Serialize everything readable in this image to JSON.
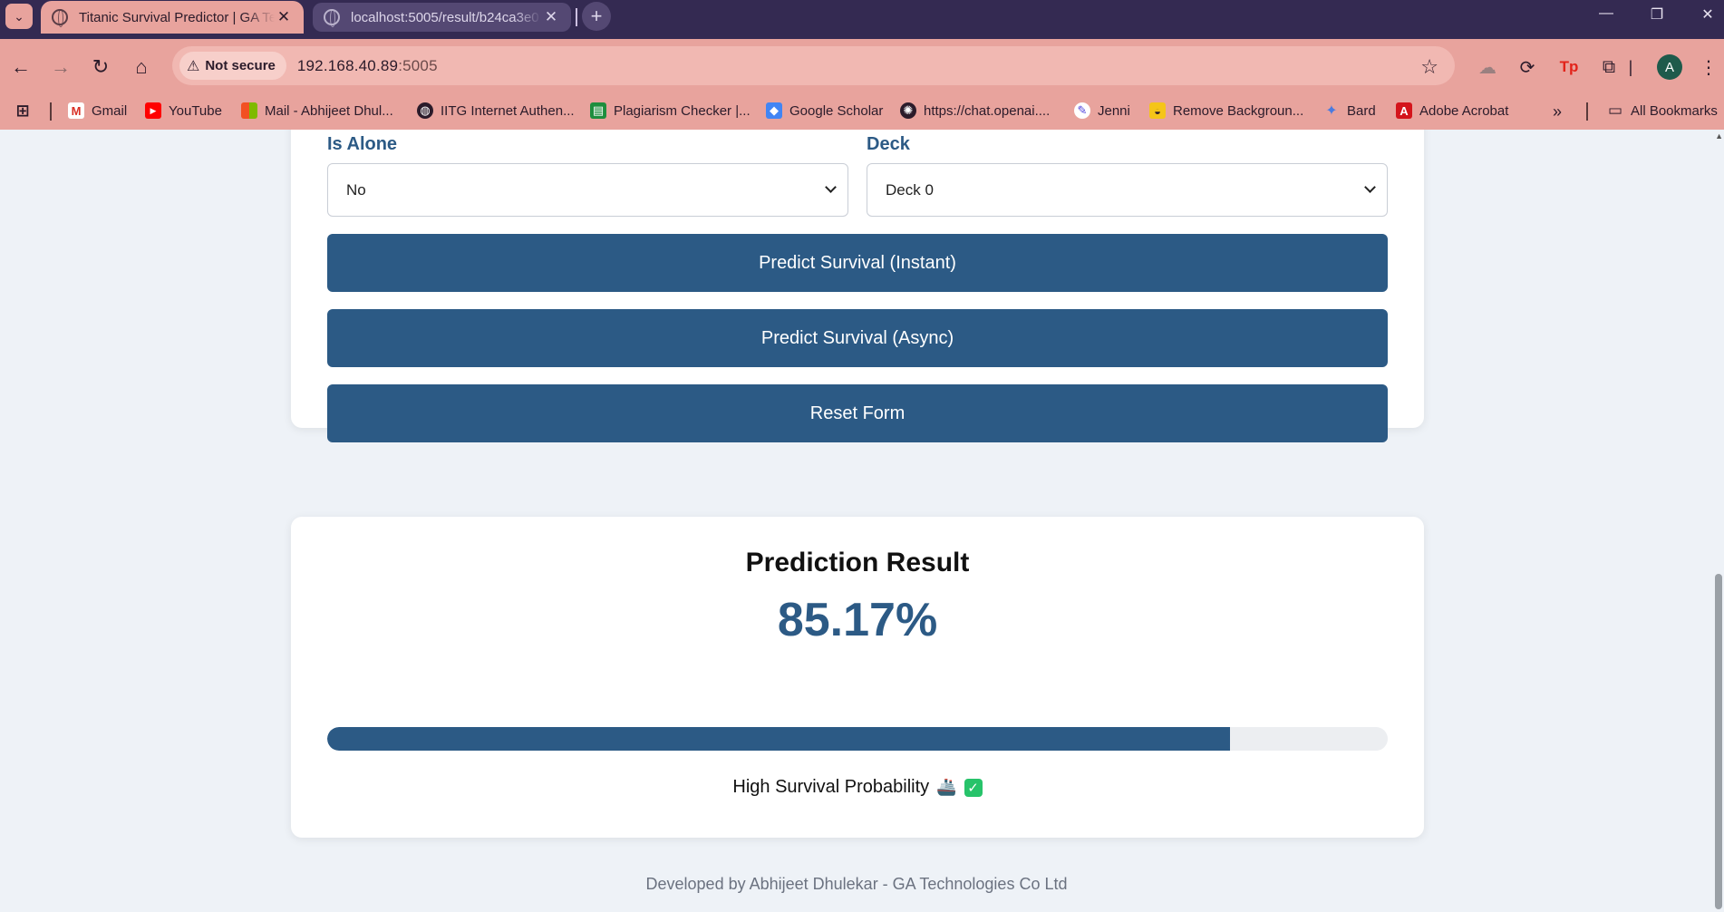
{
  "browser": {
    "tabs": [
      {
        "title": "Titanic Survival Predictor | GA Te",
        "active": true
      },
      {
        "title": "localhost:5005/result/b24ca3e0",
        "active": false
      }
    ],
    "new_tab": "+",
    "security": "Not secure",
    "url_host": "192.168.40.89",
    "url_port": ":5005",
    "bookmarks": [
      {
        "label": "Gmail",
        "icon": "gmail-icon"
      },
      {
        "label": "YouTube",
        "icon": "youtube-icon"
      },
      {
        "label": "Mail - Abhijeet Dhul...",
        "icon": "microsoft-icon"
      },
      {
        "label": "IITG Internet Authen...",
        "icon": "globe-icon"
      },
      {
        "label": "Plagiarism Checker |...",
        "icon": "document-icon"
      },
      {
        "label": "Google Scholar",
        "icon": "scholar-icon"
      },
      {
        "label": "https://chat.openai....",
        "icon": "openai-icon"
      },
      {
        "label": "Jenni",
        "icon": "jenni-icon"
      },
      {
        "label": "Remove Backgroun...",
        "icon": "removebg-icon"
      },
      {
        "label": "Bard",
        "icon": "bard-icon"
      },
      {
        "label": "Adobe Acrobat",
        "icon": "acrobat-icon"
      }
    ],
    "all_bookmarks": "All Bookmarks",
    "profile_initial": "A"
  },
  "form": {
    "is_alone": {
      "label": "Is Alone",
      "value": "No"
    },
    "deck": {
      "label": "Deck",
      "value": "Deck 0"
    },
    "buttons": {
      "predict_instant": "Predict Survival (Instant)",
      "predict_async": "Predict Survival (Async)",
      "reset": "Reset Form"
    }
  },
  "result": {
    "title": "Prediction Result",
    "probability_text": "85.17%",
    "probability": 0.8517,
    "message": "High Survival Probability",
    "icons": [
      "ship-icon",
      "check-icon"
    ]
  },
  "footer": "Developed by Abhijeet Dhulekar - GA Technologies Co Ltd",
  "colors": {
    "primary": "#2c5a85",
    "tab_bar": "#342a52",
    "toolbar": "#e8a39d",
    "page_bg": "#eef2f7",
    "success": "#27c36a"
  }
}
